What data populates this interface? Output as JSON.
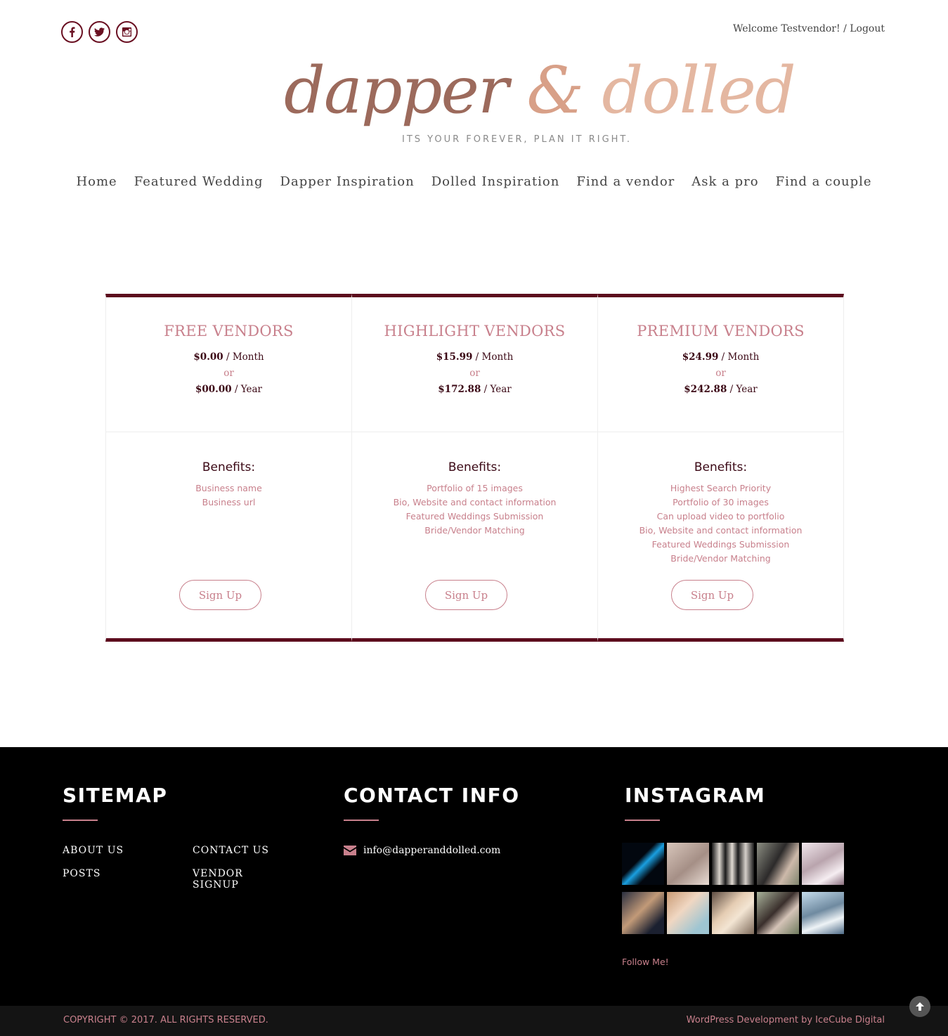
{
  "header": {
    "welcome_text": "Welcome Testvendor!",
    "separator": "/",
    "logout_label": "Logout",
    "logo_word1": "dapper",
    "logo_amp": "&",
    "logo_word2": "dolled",
    "tagline": "ITS YOUR FOREVER, PLAN IT RIGHT."
  },
  "nav": [
    "Home",
    "Featured Wedding",
    "Dapper Inspiration",
    "Dolled Inspiration",
    "Find a vendor",
    "Ask a pro",
    "Find a couple"
  ],
  "plans": [
    {
      "title": "FREE VENDORS",
      "monthly_price": "$0.00",
      "month_unit": "/ Month",
      "or": "or",
      "yearly_price": "$00.00",
      "year_unit": "/ Year",
      "benefits_title": "Benefits:",
      "benefits": [
        "Business name",
        "Business url"
      ],
      "button": "Sign Up"
    },
    {
      "title": "HIGHLIGHT VENDORS",
      "monthly_price": "$15.99",
      "month_unit": "/ Month",
      "or": "or",
      "yearly_price": "$172.88",
      "year_unit": "/ Year",
      "benefits_title": "Benefits:",
      "benefits": [
        "Portfolio of 15 images",
        "Bio, Website and contact information",
        "Featured Weddings Submission",
        "Bride/Vendor Matching"
      ],
      "button": "Sign Up"
    },
    {
      "title": "PREMIUM VENDORS",
      "monthly_price": "$24.99",
      "month_unit": "/ Month",
      "or": "or",
      "yearly_price": "$242.88",
      "year_unit": "/ Year",
      "benefits_title": "Benefits:",
      "benefits": [
        "Highest Search Priority",
        "Portfolio of 30 images",
        "Can upload video to portfolio",
        "Bio, Website and contact information",
        "Featured Weddings Submission",
        "Bride/Vendor Matching"
      ],
      "button": "Sign Up"
    }
  ],
  "footer": {
    "sitemap_title": "SITEMAP",
    "sitemap_links": [
      "ABOUT US",
      "CONTACT US",
      "POSTS",
      "VENDOR SIGNUP"
    ],
    "contact_title": "CONTACT INFO",
    "email": "info@dapperanddolled.com",
    "instagram_title": "INSTAGRAM",
    "follow_label": "Follow Me!",
    "copyright": "COPYRIGHT © 2017. ALL RIGHTS RESERVED.",
    "credit": "WordPress Development by IceCube Digital"
  },
  "colors": {
    "brand_dark": "#5c0b1d",
    "accent_rose": "#c8808c",
    "footer_bg": "#000000"
  },
  "icons": [
    "facebook-icon",
    "twitter-icon",
    "instagram-icon",
    "envelope-icon",
    "arrow-up-icon"
  ]
}
